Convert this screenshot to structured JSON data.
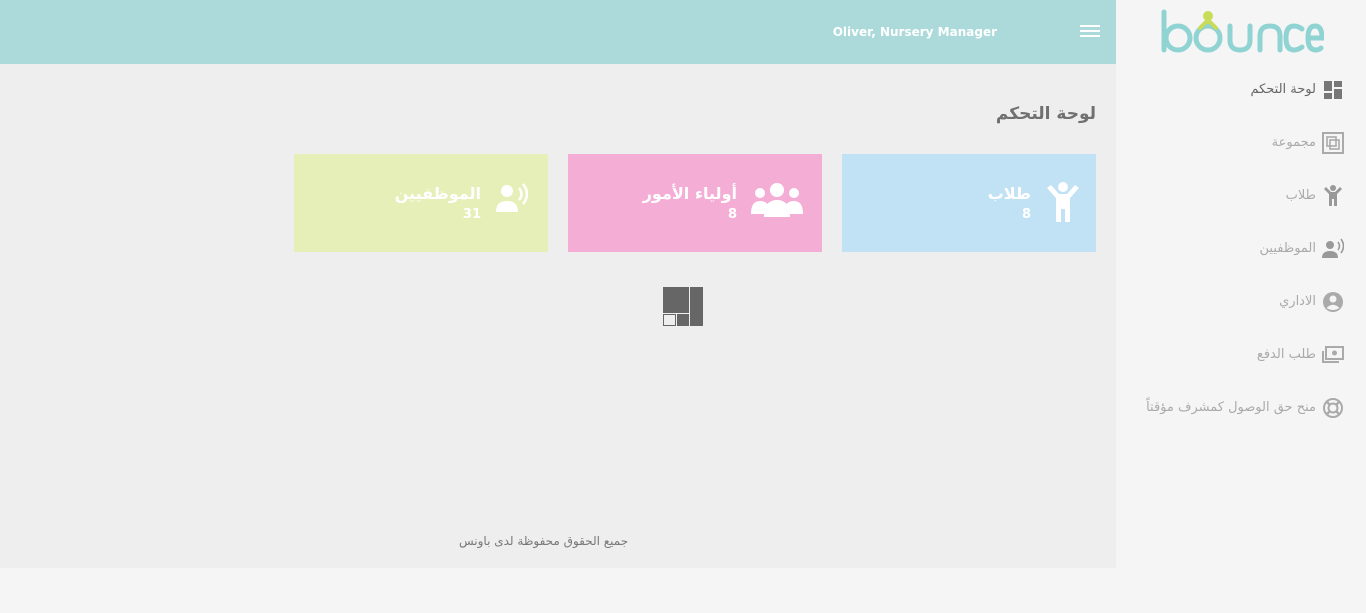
{
  "app": {
    "logo_text": "bounce"
  },
  "header": {
    "user": "Oliver, Nursery Manager"
  },
  "page": {
    "title": "لوحة التحكم"
  },
  "cards": [
    {
      "label": "طلاب",
      "count": "8",
      "color": "#c1e1f5",
      "icon": "child-icon"
    },
    {
      "label": "أولياء الأمور",
      "count": "8",
      "color": "#f4aed6",
      "icon": "group-icon"
    },
    {
      "label": "الموظفيين",
      "count": "31",
      "color": "#e7efb8",
      "icon": "staff-speaking-icon"
    }
  ],
  "sidebar": {
    "items": [
      {
        "label": "لوحة التحكم",
        "icon": "dashboard-icon"
      },
      {
        "label": "مجموعة",
        "icon": "collection-icon"
      },
      {
        "label": "طلاب",
        "icon": "child-icon"
      },
      {
        "label": "الموظفيين",
        "icon": "staff-speaking-icon"
      },
      {
        "label": "الاداري",
        "icon": "account-circle-icon"
      },
      {
        "label": "طلب الدفع",
        "icon": "money-icon"
      },
      {
        "label": "منح حق الوصول كمشرف مؤقتاً",
        "icon": "lifebuoy-icon"
      }
    ]
  },
  "footer": {
    "text": "جميع الحقوق محفوظة لدى باونس"
  },
  "colors": {
    "header": "#acdadb",
    "logo_teal": "#8fd3d3",
    "logo_yellow": "#c8dc5a"
  }
}
